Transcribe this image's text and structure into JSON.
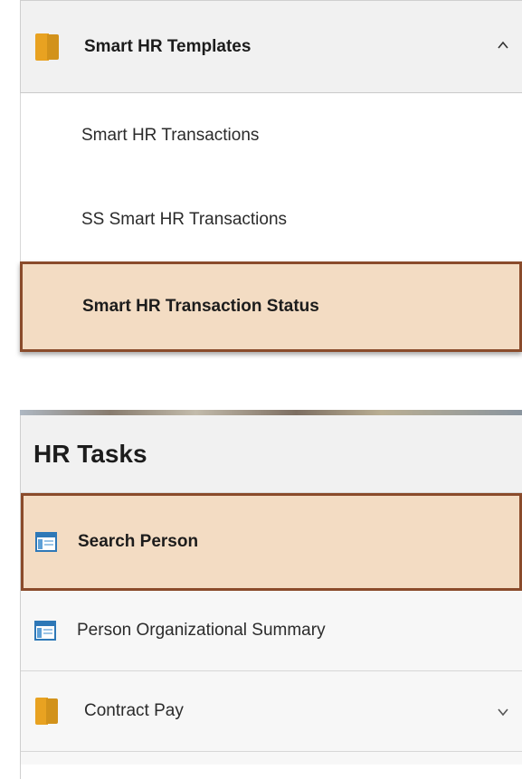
{
  "templates_panel": {
    "title": "Smart HR Templates",
    "header_icon": "folder-icon",
    "collapse_icon": "chevron-up-icon",
    "items": [
      {
        "label": "Smart HR Transactions",
        "selected": false
      },
      {
        "label": "SS Smart HR Transactions",
        "selected": false
      },
      {
        "label": "Smart HR Transaction Status",
        "selected": true
      }
    ]
  },
  "tasks_panel": {
    "title": "HR Tasks",
    "items": [
      {
        "label": "Search Person",
        "icon": "page-icon",
        "selected": true
      },
      {
        "label": "Person Organizational Summary",
        "icon": "page-icon",
        "selected": false
      },
      {
        "label": "Contract Pay",
        "icon": "folder-icon",
        "expand_icon": "chevron-down-icon",
        "selected": false
      }
    ]
  },
  "colors": {
    "selected_background": "#f3dcc3",
    "selected_border": "#8a4b2b",
    "header_background": "#f1f1f1",
    "folder": "#e8a221",
    "page_icon": "#2e78b7"
  }
}
